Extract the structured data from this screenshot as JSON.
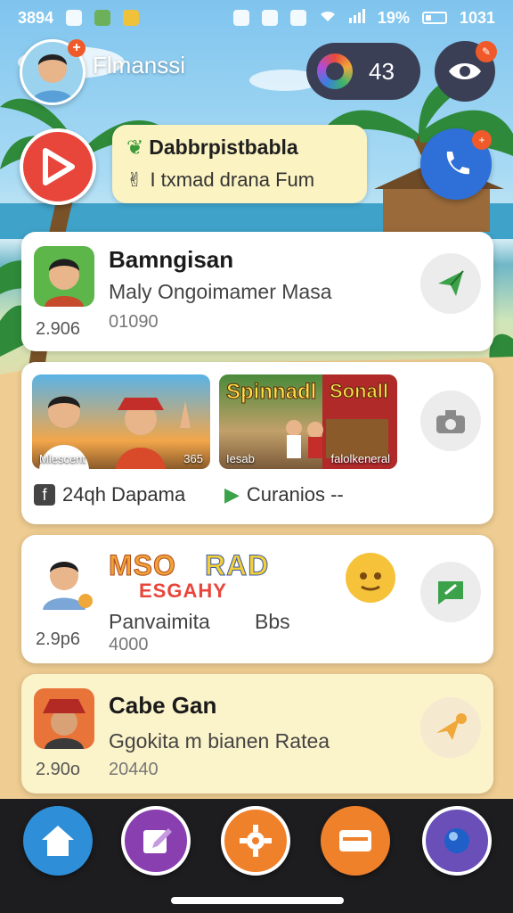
{
  "status_bar": {
    "time_left": "3894",
    "battery": "19%",
    "clock": "1031"
  },
  "header": {
    "username": "Flmanssi",
    "coins": "43",
    "eye_badge": ""
  },
  "promo": {
    "title": "Dabbrpistbabla",
    "subtitle": "I txmad drana Fum"
  },
  "cards": [
    {
      "title": "Bamngisan",
      "subtitle": "Maly Ongoimamer Masa",
      "stat": "2.906",
      "count": "01090"
    },
    {
      "media": [
        {
          "headline": "",
          "label_left": "Mlescent",
          "label_right": "365"
        },
        {
          "headline": "Spinnadl",
          "headline2": "Sonall",
          "label_left": "Iesab",
          "label_right": "falolkeneral"
        }
      ],
      "foot_left": "24qh Dapama",
      "foot_right": "Curanios --"
    },
    {
      "logo_line1": "MSO",
      "logo_line1b": "RAD",
      "logo_line2": "ESGAHY",
      "subtitle": "Panvaimita",
      "subtitle2": "Bbs",
      "stat": "2.9p6",
      "count": "4000"
    },
    {
      "title": "Cabe Gan",
      "subtitle": "Ggokita m bianen Ratea",
      "stat": "2.90o",
      "count": "20440"
    }
  ],
  "nav": [
    "home",
    "edit",
    "settings",
    "wallet",
    "profile"
  ],
  "colors": {
    "accent_red": "#e8453b",
    "nav_blue": "#2e8fd8",
    "nav_purple": "#8a3fb0",
    "nav_orange": "#f0812b"
  }
}
